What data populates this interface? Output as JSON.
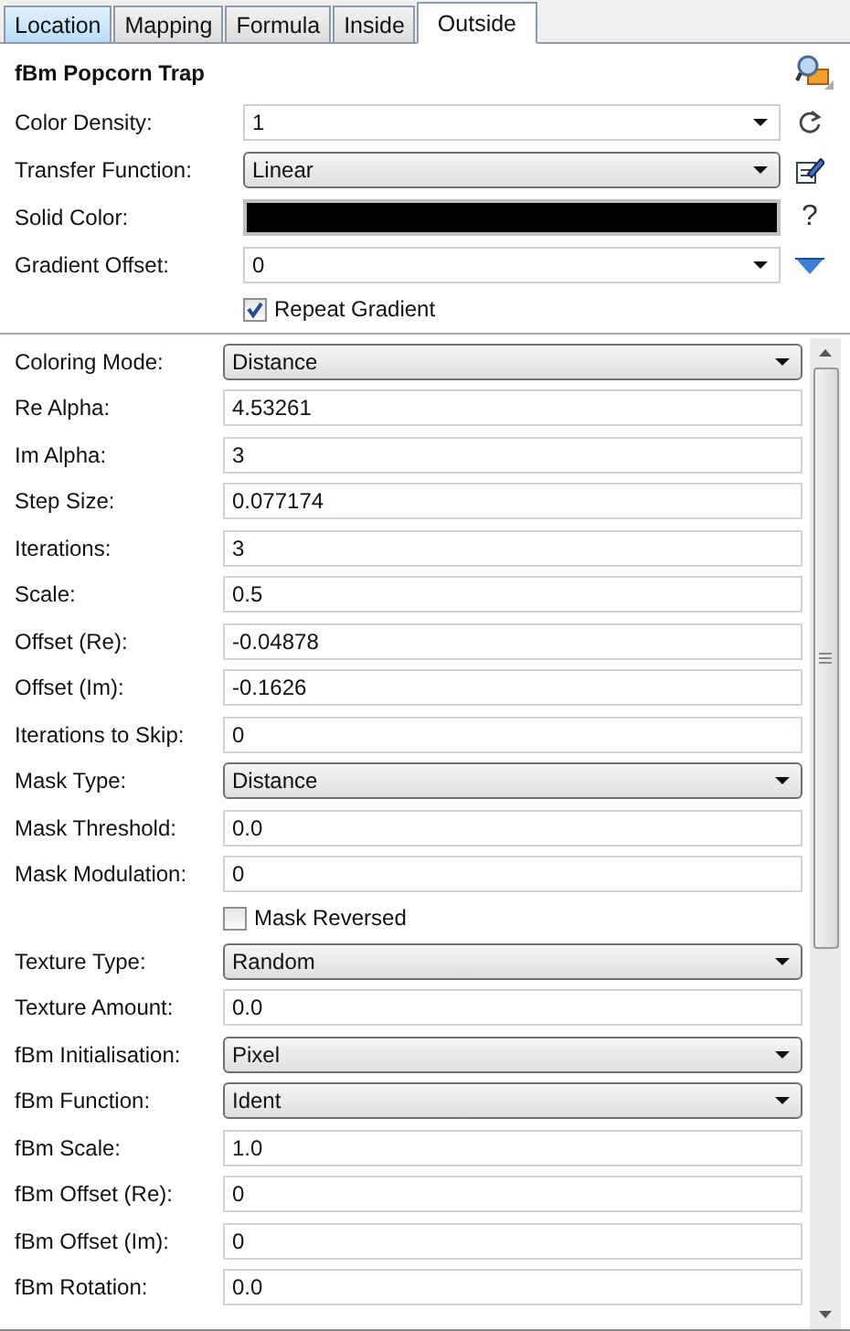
{
  "tabs": [
    {
      "label": "Location",
      "selected": false
    },
    {
      "label": "Mapping",
      "selected": false
    },
    {
      "label": "Formula",
      "selected": false
    },
    {
      "label": "Inside",
      "selected": false
    },
    {
      "label": "Outside",
      "selected": true
    }
  ],
  "title": "fBm Popcorn Trap",
  "top_rows": [
    {
      "label": "Color Density:",
      "kind": "combo",
      "value": "1",
      "action": {
        "kind": "reset"
      }
    },
    {
      "label": "Transfer Function:",
      "kind": "dropdown",
      "value": "Linear",
      "action": {
        "kind": "edit"
      }
    },
    {
      "label": "Solid Color:",
      "kind": "color",
      "color": "#000000",
      "action": {
        "kind": "help",
        "label": "?"
      }
    },
    {
      "label": "Gradient Offset:",
      "kind": "combo",
      "value": "0",
      "action": {
        "kind": "menu"
      }
    },
    {
      "kind": "checkbox",
      "label": "Repeat Gradient",
      "checked": true
    }
  ],
  "params": [
    {
      "label": "Coloring Mode:",
      "kind": "dropdown",
      "value": "Distance"
    },
    {
      "label": "Re Alpha:",
      "kind": "text",
      "value": "4.53261"
    },
    {
      "label": "Im Alpha:",
      "kind": "text",
      "value": "3"
    },
    {
      "label": "Step Size:",
      "kind": "text",
      "value": "0.077174"
    },
    {
      "label": "Iterations:",
      "kind": "text",
      "value": "3"
    },
    {
      "label": "Scale:",
      "kind": "text",
      "value": "0.5"
    },
    {
      "label": "Offset (Re):",
      "kind": "text",
      "value": "-0.04878"
    },
    {
      "label": "Offset (Im):",
      "kind": "text",
      "value": "-0.1626"
    },
    {
      "label": "Iterations to Skip:",
      "kind": "text",
      "value": "0"
    },
    {
      "label": "Mask Type:",
      "kind": "dropdown",
      "value": "Distance"
    },
    {
      "label": "Mask Threshold:",
      "kind": "text",
      "value": "0.0"
    },
    {
      "label": "Mask Modulation:",
      "kind": "text",
      "value": "0"
    },
    {
      "kind": "checkbox",
      "label": "Mask Reversed",
      "checked": false
    },
    {
      "label": "Texture Type:",
      "kind": "dropdown",
      "value": "Random"
    },
    {
      "label": "Texture Amount:",
      "kind": "text",
      "value": "0.0"
    },
    {
      "label": "fBm Initialisation:",
      "kind": "dropdown",
      "value": "Pixel"
    },
    {
      "label": "fBm Function:",
      "kind": "dropdown",
      "value": "Ident"
    },
    {
      "label": "fBm Scale:",
      "kind": "text",
      "value": "1.0"
    },
    {
      "label": "fBm Offset (Re):",
      "kind": "text",
      "value": "0"
    },
    {
      "label": "fBm Offset (Im):",
      "kind": "text",
      "value": "0"
    },
    {
      "label": "fBm Rotation:",
      "kind": "text",
      "value": "0.0"
    }
  ]
}
